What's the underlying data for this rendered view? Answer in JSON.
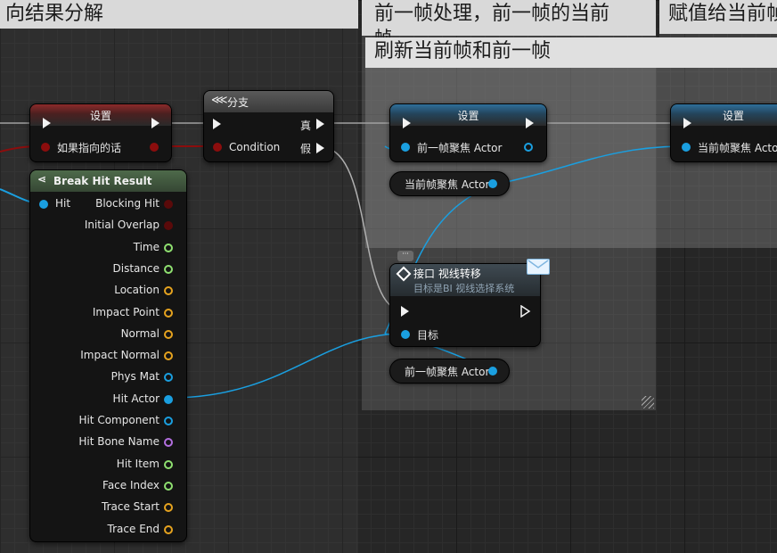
{
  "comments": {
    "left": "向结果分解",
    "middle_line1": "前一帧处理，前一帧的当前",
    "middle_line2": "帧",
    "middle_sub": "刷新当前帧和前一帧",
    "right": "赋值给当前帧"
  },
  "set_node_1": {
    "title": "设置",
    "pin": "如果指向的话"
  },
  "branch_node": {
    "title": "分支",
    "condition": "Condition",
    "true_label": "真",
    "false_label": "假"
  },
  "set_node_2": {
    "title": "设置",
    "pin": "前一帧聚焦 Actor"
  },
  "set_node_3": {
    "title": "设置",
    "pin": "当前帧聚焦 Actor"
  },
  "var_current": {
    "label": "当前帧聚焦 Actor"
  },
  "var_previous": {
    "label": "前一帧聚焦 Actor"
  },
  "interface_node": {
    "title": "接口 视线转移",
    "subtitle": "目标是BI 视线选择系统",
    "target": "目标"
  },
  "break_hit": {
    "title": "Break Hit Result",
    "input": "Hit",
    "outputs": [
      {
        "label": "Blocking Hit",
        "type": "bool"
      },
      {
        "label": "Initial Overlap",
        "type": "bool"
      },
      {
        "label": "Time",
        "type": "float"
      },
      {
        "label": "Distance",
        "type": "float"
      },
      {
        "label": "Location",
        "type": "vector"
      },
      {
        "label": "Impact Point",
        "type": "vector"
      },
      {
        "label": "Normal",
        "type": "vector"
      },
      {
        "label": "Impact Normal",
        "type": "vector"
      },
      {
        "label": "Phys Mat",
        "type": "object"
      },
      {
        "label": "Hit Actor",
        "type": "object-connected"
      },
      {
        "label": "Hit Component",
        "type": "object"
      },
      {
        "label": "Hit Bone Name",
        "type": "name"
      },
      {
        "label": "Hit Item",
        "type": "int"
      },
      {
        "label": "Face Index",
        "type": "int"
      },
      {
        "label": "Trace Start",
        "type": "vector"
      },
      {
        "label": "Trace End",
        "type": "vector"
      }
    ]
  },
  "colors": {
    "exec": "#f2f2f2",
    "object": "#1a9fe0",
    "bool": "#8c0d0d",
    "float": "#8fe070",
    "vector": "#e6a31f",
    "name": "#b36fe0"
  }
}
